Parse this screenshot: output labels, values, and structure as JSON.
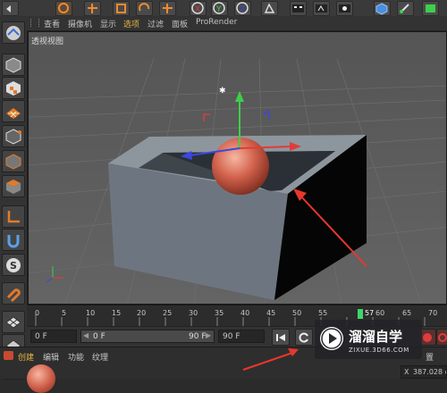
{
  "menu": {
    "items": [
      "查看",
      "摄像机",
      "显示",
      "选项",
      "过滤",
      "面板",
      "ProRender"
    ],
    "active_index": 3
  },
  "viewport": {
    "label": "透视视图"
  },
  "timeline": {
    "ticks": [
      "0",
      "5",
      "10",
      "15",
      "20",
      "25",
      "30",
      "35",
      "40",
      "45",
      "50",
      "55",
      "57",
      "60",
      "65",
      "70"
    ],
    "current_frame": "57"
  },
  "controls": {
    "start_frame": "0 F",
    "range_start": "0 F",
    "range_end": "90 F",
    "end_frame": "90 F"
  },
  "materials": {
    "menu": [
      "创建",
      "编辑",
      "功能",
      "纹理"
    ],
    "right_label": "置",
    "coord_label": "X",
    "coord_value": "387.028 c"
  },
  "watermark": {
    "brand": "溜溜自学",
    "url": "ZIXUE.3D66.COM"
  },
  "colors": {
    "accent": "#e8b441",
    "timeline_marker": "#3fd66a",
    "sphere": "#d2624c",
    "axis_x": "#e03b3b",
    "axis_y": "#3ecf4a",
    "axis_z": "#3a47e0",
    "arrow": "#e8372c"
  },
  "icons": {
    "top_toolbar": [
      "undo-icon",
      "move-icon",
      "scale-icon",
      "rotate-icon",
      "select-icon",
      "x-axis-icon",
      "y-axis-icon",
      "z-axis-icon",
      "coordinate-icon",
      "render-icon",
      "render-view-icon",
      "render-settings-icon",
      "cube-icon",
      "pen-icon",
      "subdivide-icon"
    ],
    "left_toolbar": [
      "object-mode-icon",
      "cube-mode-icon",
      "checker-icon",
      "texture-icon",
      "points-icon",
      "edges-icon",
      "polygons-icon",
      "axis-icon",
      "magnet-icon",
      "snap-icon",
      "grid-icon",
      "lock-icon"
    ]
  }
}
